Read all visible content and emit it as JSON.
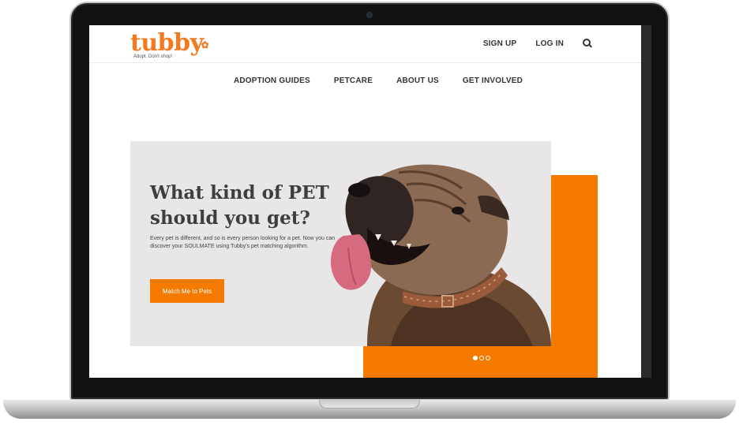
{
  "brand": {
    "name": "tubby",
    "tagline": "Adopt. Don't shop!",
    "accent": "#f47a00"
  },
  "topnav": {
    "signup": "SIGN UP",
    "login": "LOG IN",
    "search_icon": "search-icon"
  },
  "mainnav": {
    "items": [
      {
        "label": "ADOPTION GUIDES"
      },
      {
        "label": "PETCARE"
      },
      {
        "label": "ABOUT US"
      },
      {
        "label": "GET INVOLVED"
      }
    ]
  },
  "hero": {
    "headline_line1": "What kind of PET",
    "headline_line2": "should you get?",
    "description": "Every pet is different, and so is every person looking for a pet. Now you can discover your SOULMATE using Tubby's pet matching algorithm.",
    "cta_label": "Match Me to Pets",
    "image": "bulldog-photo",
    "carousel": {
      "total": 3,
      "active": 1
    }
  }
}
